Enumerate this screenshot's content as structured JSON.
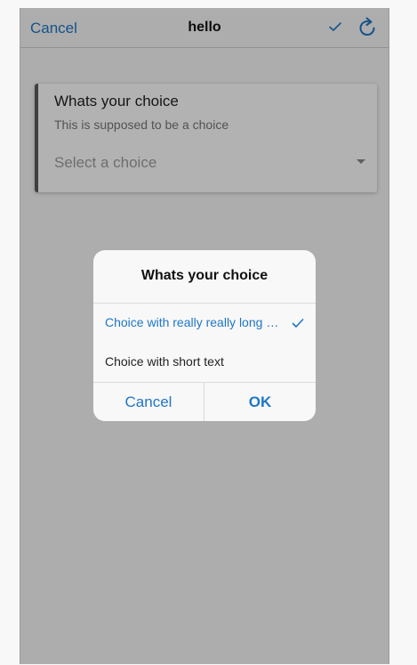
{
  "navbar": {
    "cancel_label": "Cancel",
    "title": "hello",
    "check_icon": "checkmark-icon",
    "refresh_icon": "refresh-icon"
  },
  "card": {
    "title": "Whats your choice",
    "subtitle": "This is supposed to be a choice",
    "select_placeholder": "Select a choice",
    "caret_icon": "dropdown-caret-icon"
  },
  "dialog": {
    "title": "Whats your choice",
    "options": [
      {
        "label": "Choice with really really long text",
        "selected": true
      },
      {
        "label": "Choice with short text",
        "selected": false
      }
    ],
    "cancel_label": "Cancel",
    "ok_label": "OK"
  },
  "colors": {
    "accent": "#1f76c5",
    "overlay": "rgba(0,0,0,0.3)"
  }
}
